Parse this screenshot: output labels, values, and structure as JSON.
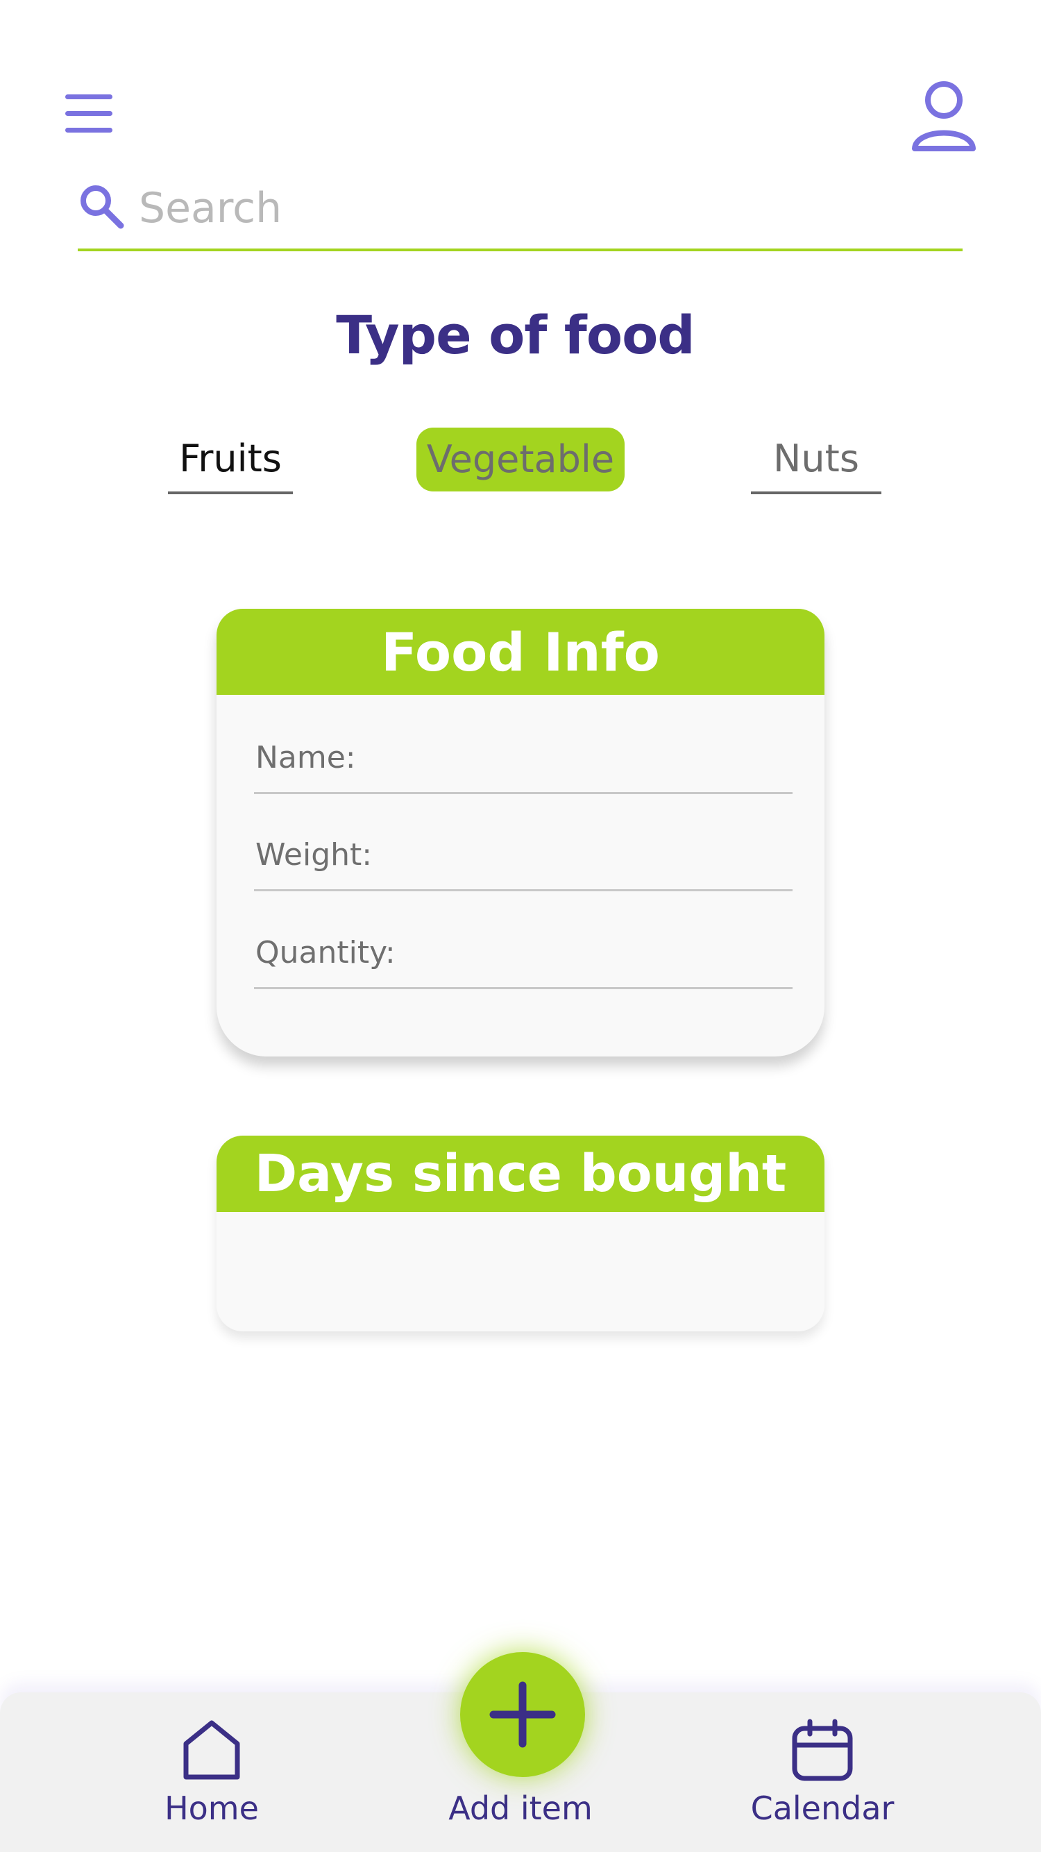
{
  "header": {
    "menu_icon": "hamburger-menu-icon",
    "profile_icon": "user-icon"
  },
  "search": {
    "placeholder": "Search",
    "value": ""
  },
  "page_title": "Type of food",
  "tabs": [
    {
      "label": "Fruits",
      "active": false
    },
    {
      "label": "Vegetable",
      "active": true
    },
    {
      "label": "Nuts",
      "active": false
    }
  ],
  "food_info": {
    "title": "Food Info",
    "fields": [
      {
        "label": "Name:"
      },
      {
        "label": "Weight:"
      },
      {
        "label": "Quantity:"
      }
    ]
  },
  "days_since_bought": {
    "title": "Days since bought"
  },
  "bottom_nav": {
    "items": [
      {
        "label": "Home",
        "icon": "home-icon"
      },
      {
        "label": "Add item",
        "icon": "plus-icon"
      },
      {
        "label": "Calendar",
        "icon": "calendar-icon"
      }
    ]
  },
  "colors": {
    "accent_green": "#a3d41f",
    "title_purple": "#3b2f86",
    "icon_violet": "#7a72e0"
  }
}
